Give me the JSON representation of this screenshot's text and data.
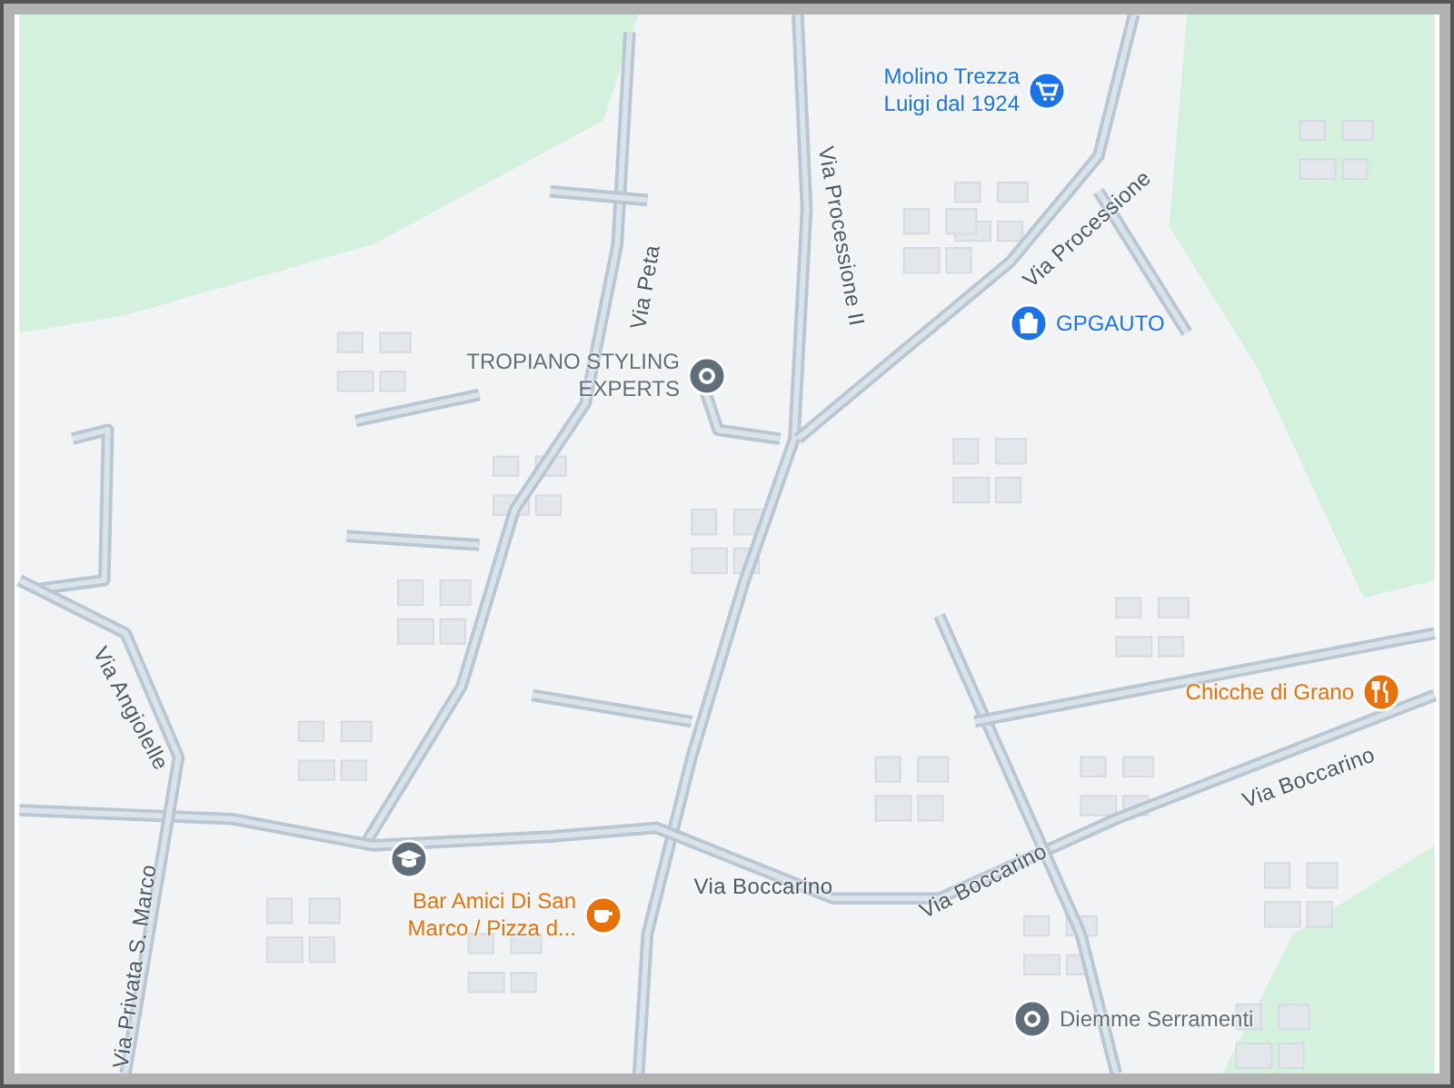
{
  "map": {
    "streets": [
      {
        "name": "Via Processione"
      },
      {
        "name": "Via Processione II"
      },
      {
        "name": "Via Peta"
      },
      {
        "name": "Via Angiolelle"
      },
      {
        "name": "Via Privata S. Marco"
      },
      {
        "name": "Via Boccarino"
      },
      {
        "name": "Via Boccarino"
      },
      {
        "name": "Via Boccarino"
      }
    ],
    "places": [
      {
        "name": "Molino Trezza Luigi dal 1924",
        "kind": "shop",
        "color": "#1a73e8"
      },
      {
        "name": "GPGAUTO",
        "kind": "store",
        "color": "#1a73e8"
      },
      {
        "name": "TROPIANO STYLING EXPERTS",
        "kind": "place",
        "color": "#5f6e78"
      },
      {
        "name": "Chicche di Grano",
        "kind": "restaurant",
        "color": "#e8710a"
      },
      {
        "name": "Bar Amici Di San Marco / Pizza d...",
        "kind": "cafe",
        "color": "#e8710a"
      },
      {
        "name": "Diemme Serramenti",
        "kind": "place",
        "color": "#5f6e78"
      },
      {
        "kind": "school",
        "color": "#5f6e78"
      }
    ]
  }
}
